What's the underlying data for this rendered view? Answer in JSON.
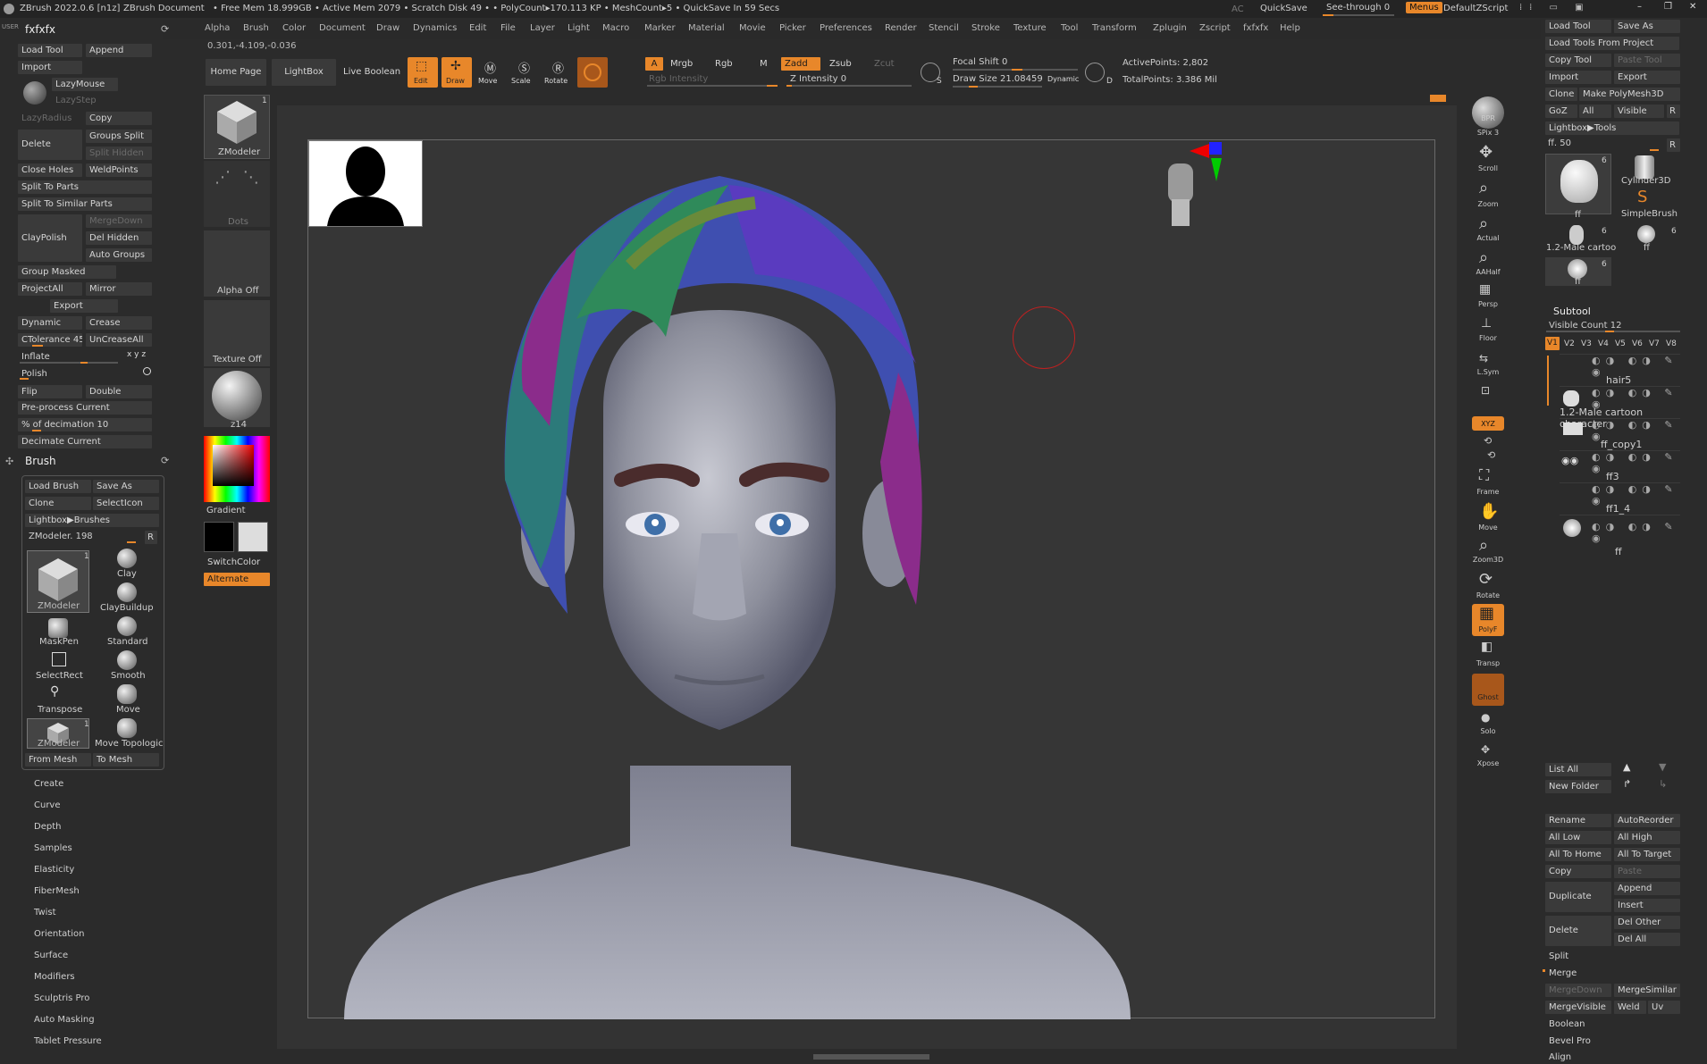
{
  "titlebar": {
    "app": "ZBrush 2022.0.6 [n1z]",
    "doc": "ZBrush Document",
    "stats": "• Free Mem 18.999GB • Active Mem 2079 • Scratch Disk 49 • • PolyCount▸170.113 KP • MeshCount▸5 • QuickSave In 59 Secs",
    "ac": "AC",
    "quicksave": "QuickSave",
    "see_through": "See-through 0",
    "menus": "Menus",
    "script": "DefaultZScript"
  },
  "menus": [
    "Alpha",
    "Brush",
    "Color",
    "Document",
    "Draw",
    "Dynamics",
    "Edit",
    "File",
    "Layer",
    "Light",
    "Macro",
    "Marker",
    "Material",
    "Movie",
    "Picker",
    "Preferences",
    "Render",
    "Stencil",
    "Stroke",
    "Texture",
    "Tool",
    "Transform",
    "Zplugin",
    "Zscript",
    "fxfxfx",
    "Help"
  ],
  "coords": "0.301,-4.109,-0.036",
  "left": {
    "user_label": "USER",
    "title": "fxfxfx",
    "buttons": {
      "load_tool": "Load Tool",
      "append": "Append",
      "import": "Import",
      "lazymouse": "LazyMouse",
      "lazystep": "LazyStep",
      "lazyradius": "LazyRadius",
      "copy": "Copy",
      "delete": "Delete",
      "groups_split": "Groups Split",
      "split_hidden": "Split Hidden",
      "close_holes": "Close Holes",
      "weldpoints": "WeldPoints",
      "split_to_parts": "Split To Parts",
      "split_similar": "Split To Similar Parts",
      "claypolish": "ClayPolish",
      "mergedown": "MergeDown",
      "del_hidden": "Del Hidden",
      "auto_groups": "Auto Groups",
      "group_masked": "Group Masked",
      "projectall": "ProjectAll",
      "mirror": "Mirror",
      "export": "Export",
      "dynamic": "Dynamic",
      "crease": "Crease",
      "ctolerance": "CTolerance 45",
      "uncreaseall": "UnCreaseAll",
      "inflate": "Inflate",
      "inflate_axes": "x y z",
      "polish": "Polish",
      "flip": "Flip",
      "double": "Double",
      "preprocess": "Pre-process Current",
      "decimation": "% of decimation 10",
      "decimate_current": "Decimate Current"
    },
    "brush_title": "Brush",
    "brush_buttons": {
      "load_brush": "Load Brush",
      "save_as": "Save As",
      "clone": "Clone",
      "selecticon": "SelectIcon",
      "lightbox_brushes": "Lightbox▶Brushes",
      "zmodeler_value": "ZModeler. 198",
      "r": "R",
      "from_mesh": "From Mesh",
      "to_mesh": "To Mesh"
    },
    "brushes": [
      {
        "name": "ZModeler",
        "count": "1"
      },
      {
        "name": "Clay"
      },
      {
        "name": "ClayBuildup"
      },
      {
        "name": "MaskPen"
      },
      {
        "name": "Standard"
      },
      {
        "name": "SelectRect"
      },
      {
        "name": "Smooth"
      },
      {
        "name": "Transpose"
      },
      {
        "name": "Move"
      },
      {
        "name": "ZModeler",
        "count": "1"
      },
      {
        "name": "Move Topologic"
      }
    ],
    "sections": [
      "Create",
      "Curve",
      "Depth",
      "Samples",
      "Elasticity",
      "FiberMesh",
      "Twist",
      "Orientation",
      "Surface",
      "Modifiers",
      "Sculptris Pro",
      "Auto Masking",
      "Tablet Pressure"
    ]
  },
  "palette": {
    "zmodeler": "ZModeler",
    "zmodeler_count": "1",
    "dots": "Dots",
    "alpha_off": "Alpha Off",
    "texture_off": "Texture Off",
    "material": "z14",
    "gradient": "Gradient",
    "switchcolor": "SwitchColor",
    "alternate": "Alternate"
  },
  "toolbar": {
    "home_page": "Home Page",
    "lightbox": "LightBox",
    "live_boolean": "Live Boolean",
    "edit": "Edit",
    "draw": "Draw",
    "move": "Move",
    "scale": "Scale",
    "rotate": "Rotate",
    "a": "A",
    "mrgb": "Mrgb",
    "rgb": "Rgb",
    "m": "M",
    "zadd": "Zadd",
    "zsub": "Zsub",
    "zcut": "Zcut",
    "rgb_intensity": "Rgb Intensity",
    "z_intensity": "Z Intensity 0",
    "focal_shift": "Focal Shift 0",
    "draw_size": "Draw Size 21.08459",
    "dynamic": "Dynamic",
    "active_points": "ActivePoints: 2,802",
    "total_points": "TotalPoints: 3.386 Mil",
    "s": "S",
    "d": "D"
  },
  "shelf": [
    "BPR",
    "SPix 3",
    "Scroll",
    "Zoom",
    "Actual",
    "AAHalf",
    "Persp",
    "Floor",
    "L.Sym",
    "",
    "XYZ",
    "",
    "",
    "Frame",
    "Move",
    "Zoom3D",
    "Rotate",
    "PolyF",
    "Transp",
    "Ghost",
    "Solo",
    "Xpose"
  ],
  "right": {
    "buttons": {
      "load_tool": "Load Tool",
      "save_as": "Save As",
      "load_tools_from_project": "Load Tools From Project",
      "copy_tool": "Copy Tool",
      "paste_tool": "Paste Tool",
      "import": "Import",
      "export": "Export",
      "clone": "Clone",
      "make_polymesh": "Make PolyMesh3D",
      "goz": "GoZ",
      "all": "All",
      "visible": "Visible",
      "r": "R",
      "lightbox_tools": "Lightbox▶Tools",
      "ff_value": "ff. 50"
    },
    "tools": [
      {
        "name": "ff",
        "count": "6"
      },
      {
        "name": "Cylinder3D"
      },
      {
        "name": "SimpleBrush"
      },
      {
        "name": "1.2-Male cartoo",
        "count": "6"
      },
      {
        "name": "ff",
        "count": "6"
      },
      {
        "name": "ff",
        "count": "6"
      }
    ],
    "subtool_title": "Subtool",
    "visible_count": "Visible Count 12",
    "versions": [
      "V1",
      "V2",
      "V3",
      "V4",
      "V5",
      "V6",
      "V7",
      "V8"
    ],
    "subtools": [
      "hair5",
      "1.2-Male cartoon character",
      "ff_copy1",
      "ff3",
      "ff1_4",
      "ff"
    ],
    "list_all": "List All",
    "new_folder": "New Folder",
    "rename": "Rename",
    "autoreorder": "AutoReorder",
    "all_low": "All Low",
    "all_high": "All High",
    "all_to_home": "All To Home",
    "all_to_target": "All To Target",
    "copy": "Copy",
    "paste": "Paste",
    "duplicate": "Duplicate",
    "append": "Append",
    "insert": "Insert",
    "delete": "Delete",
    "del_other": "Del Other",
    "del_all": "Del All",
    "split": "Split",
    "merge": "Merge",
    "mergedown": "MergeDown",
    "mergesimilar": "MergeSimilar",
    "mergevisible": "MergeVisible",
    "weld": "Weld",
    "uv": "Uv",
    "boolean": "Boolean",
    "bevel_pro": "Bevel Pro",
    "align": "Align"
  },
  "colors": {
    "accent": "#e8872a",
    "bg": "#2b2b2b",
    "button": "#3a3a3a"
  }
}
